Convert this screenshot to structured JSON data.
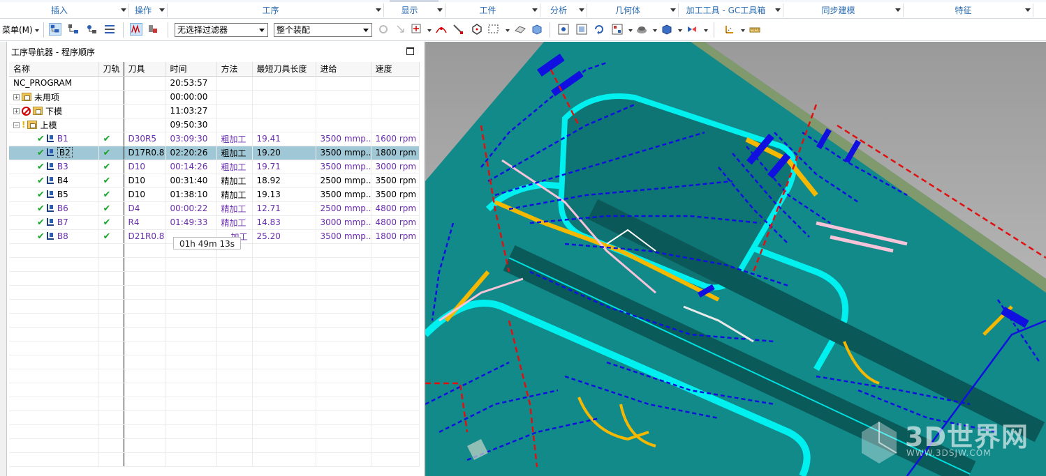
{
  "ribbon": {
    "groups": [
      {
        "label": "插入"
      },
      {
        "label": "操作"
      },
      {
        "label": "工序"
      },
      {
        "label": "显示"
      },
      {
        "label": "工件"
      },
      {
        "label": "分析"
      },
      {
        "label": "几何体"
      },
      {
        "label": "加工工具 - GC工具箱"
      },
      {
        "label": "同步建模"
      },
      {
        "label": "特征"
      }
    ]
  },
  "toolbar": {
    "menu_label": "菜单(M)",
    "filter_value": "无选择过滤器",
    "assembly_value": "整个装配"
  },
  "navigator": {
    "title": "工序导航器 - 程序顺序",
    "columns": [
      "名称",
      "刀轨",
      "刀具",
      "时间",
      "方法",
      "最短刀具长度",
      "进给",
      "速度"
    ],
    "groups": [
      {
        "name": "NC_PROGRAM",
        "time": "20:53:57"
      },
      {
        "name": "未用项",
        "time": "00:00:00"
      },
      {
        "name": "下模",
        "time": "11:03:27"
      },
      {
        "name": "上模",
        "time": "09:50:30"
      }
    ],
    "operations": [
      {
        "name": "B1",
        "tool": "D30R5",
        "time": "03:09:30",
        "method": "粗加工",
        "min_len": "19.41",
        "feed": "3500 mmp...",
        "speed": "1600 rpm"
      },
      {
        "name": "B2",
        "tool": "D17R0.8",
        "time": "02:20:26",
        "method": "粗加工",
        "min_len": "19.20",
        "feed": "3500 mmp...",
        "speed": "1800 rpm"
      },
      {
        "name": "B3",
        "tool": "D10",
        "time": "00:14:26",
        "method": "粗加工",
        "min_len": "19.71",
        "feed": "3500 mmp...",
        "speed": "3000 rpm"
      },
      {
        "name": "B4",
        "tool": "D10",
        "time": "00:31:40",
        "method": "精加工",
        "min_len": "18.92",
        "feed": "2500 mmp...",
        "speed": "3500 rpm"
      },
      {
        "name": "B5",
        "tool": "D10",
        "time": "01:38:10",
        "method": "精加工",
        "min_len": "19.13",
        "feed": "3500 mmp...",
        "speed": "3500 rpm"
      },
      {
        "name": "B6",
        "tool": "D4",
        "time": "00:00:22",
        "method": "精加工",
        "min_len": "12.71",
        "feed": "2500 mmp...",
        "speed": "4800 rpm"
      },
      {
        "name": "B7",
        "tool": "R4",
        "time": "01:49:33",
        "method": "精加工",
        "min_len": "14.83",
        "feed": "3000 mmp...",
        "speed": "4800 rpm"
      },
      {
        "name": "B8",
        "tool": "D21R0.8",
        "time": "",
        "method": "",
        "min_len": "25.20",
        "feed": "3500 mmp...",
        "speed": "1800 rpm"
      }
    ],
    "b8_method_partial": "加工",
    "tooltip": "01h 49m 13s"
  },
  "watermark": {
    "text": "3D世界网",
    "url": "WWW.3DSJW.COM"
  },
  "colors": {
    "accent": "#2a6db3",
    "selection": "#9fc7d5",
    "op_text": "#6a2db0",
    "model_teal": "#138a8a",
    "model_cyan": "#00f0f0",
    "toolpath_blue": "#1010e0",
    "toolpath_red": "#e01010",
    "toolpath_yellow": "#f5b800"
  }
}
